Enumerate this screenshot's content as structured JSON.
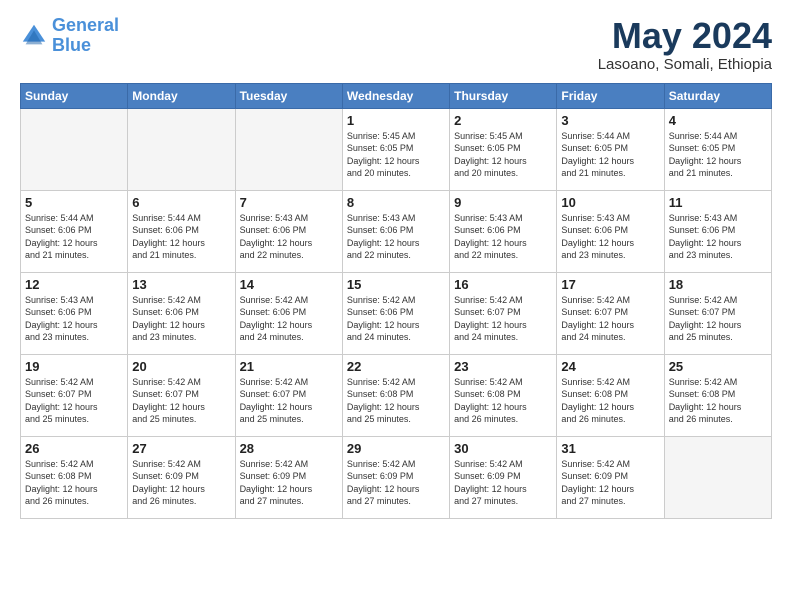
{
  "header": {
    "logo_line1": "General",
    "logo_line2": "Blue",
    "month": "May 2024",
    "location": "Lasoano, Somali, Ethiopia"
  },
  "weekdays": [
    "Sunday",
    "Monday",
    "Tuesday",
    "Wednesday",
    "Thursday",
    "Friday",
    "Saturday"
  ],
  "weeks": [
    [
      {
        "day": "",
        "info": ""
      },
      {
        "day": "",
        "info": ""
      },
      {
        "day": "",
        "info": ""
      },
      {
        "day": "1",
        "info": "Sunrise: 5:45 AM\nSunset: 6:05 PM\nDaylight: 12 hours\nand 20 minutes."
      },
      {
        "day": "2",
        "info": "Sunrise: 5:45 AM\nSunset: 6:05 PM\nDaylight: 12 hours\nand 20 minutes."
      },
      {
        "day": "3",
        "info": "Sunrise: 5:44 AM\nSunset: 6:05 PM\nDaylight: 12 hours\nand 21 minutes."
      },
      {
        "day": "4",
        "info": "Sunrise: 5:44 AM\nSunset: 6:05 PM\nDaylight: 12 hours\nand 21 minutes."
      }
    ],
    [
      {
        "day": "5",
        "info": "Sunrise: 5:44 AM\nSunset: 6:06 PM\nDaylight: 12 hours\nand 21 minutes."
      },
      {
        "day": "6",
        "info": "Sunrise: 5:44 AM\nSunset: 6:06 PM\nDaylight: 12 hours\nand 21 minutes."
      },
      {
        "day": "7",
        "info": "Sunrise: 5:43 AM\nSunset: 6:06 PM\nDaylight: 12 hours\nand 22 minutes."
      },
      {
        "day": "8",
        "info": "Sunrise: 5:43 AM\nSunset: 6:06 PM\nDaylight: 12 hours\nand 22 minutes."
      },
      {
        "day": "9",
        "info": "Sunrise: 5:43 AM\nSunset: 6:06 PM\nDaylight: 12 hours\nand 22 minutes."
      },
      {
        "day": "10",
        "info": "Sunrise: 5:43 AM\nSunset: 6:06 PM\nDaylight: 12 hours\nand 23 minutes."
      },
      {
        "day": "11",
        "info": "Sunrise: 5:43 AM\nSunset: 6:06 PM\nDaylight: 12 hours\nand 23 minutes."
      }
    ],
    [
      {
        "day": "12",
        "info": "Sunrise: 5:43 AM\nSunset: 6:06 PM\nDaylight: 12 hours\nand 23 minutes."
      },
      {
        "day": "13",
        "info": "Sunrise: 5:42 AM\nSunset: 6:06 PM\nDaylight: 12 hours\nand 23 minutes."
      },
      {
        "day": "14",
        "info": "Sunrise: 5:42 AM\nSunset: 6:06 PM\nDaylight: 12 hours\nand 24 minutes."
      },
      {
        "day": "15",
        "info": "Sunrise: 5:42 AM\nSunset: 6:06 PM\nDaylight: 12 hours\nand 24 minutes."
      },
      {
        "day": "16",
        "info": "Sunrise: 5:42 AM\nSunset: 6:07 PM\nDaylight: 12 hours\nand 24 minutes."
      },
      {
        "day": "17",
        "info": "Sunrise: 5:42 AM\nSunset: 6:07 PM\nDaylight: 12 hours\nand 24 minutes."
      },
      {
        "day": "18",
        "info": "Sunrise: 5:42 AM\nSunset: 6:07 PM\nDaylight: 12 hours\nand 25 minutes."
      }
    ],
    [
      {
        "day": "19",
        "info": "Sunrise: 5:42 AM\nSunset: 6:07 PM\nDaylight: 12 hours\nand 25 minutes."
      },
      {
        "day": "20",
        "info": "Sunrise: 5:42 AM\nSunset: 6:07 PM\nDaylight: 12 hours\nand 25 minutes."
      },
      {
        "day": "21",
        "info": "Sunrise: 5:42 AM\nSunset: 6:07 PM\nDaylight: 12 hours\nand 25 minutes."
      },
      {
        "day": "22",
        "info": "Sunrise: 5:42 AM\nSunset: 6:08 PM\nDaylight: 12 hours\nand 25 minutes."
      },
      {
        "day": "23",
        "info": "Sunrise: 5:42 AM\nSunset: 6:08 PM\nDaylight: 12 hours\nand 26 minutes."
      },
      {
        "day": "24",
        "info": "Sunrise: 5:42 AM\nSunset: 6:08 PM\nDaylight: 12 hours\nand 26 minutes."
      },
      {
        "day": "25",
        "info": "Sunrise: 5:42 AM\nSunset: 6:08 PM\nDaylight: 12 hours\nand 26 minutes."
      }
    ],
    [
      {
        "day": "26",
        "info": "Sunrise: 5:42 AM\nSunset: 6:08 PM\nDaylight: 12 hours\nand 26 minutes."
      },
      {
        "day": "27",
        "info": "Sunrise: 5:42 AM\nSunset: 6:09 PM\nDaylight: 12 hours\nand 26 minutes."
      },
      {
        "day": "28",
        "info": "Sunrise: 5:42 AM\nSunset: 6:09 PM\nDaylight: 12 hours\nand 27 minutes."
      },
      {
        "day": "29",
        "info": "Sunrise: 5:42 AM\nSunset: 6:09 PM\nDaylight: 12 hours\nand 27 minutes."
      },
      {
        "day": "30",
        "info": "Sunrise: 5:42 AM\nSunset: 6:09 PM\nDaylight: 12 hours\nand 27 minutes."
      },
      {
        "day": "31",
        "info": "Sunrise: 5:42 AM\nSunset: 6:09 PM\nDaylight: 12 hours\nand 27 minutes."
      },
      {
        "day": "",
        "info": ""
      }
    ]
  ]
}
